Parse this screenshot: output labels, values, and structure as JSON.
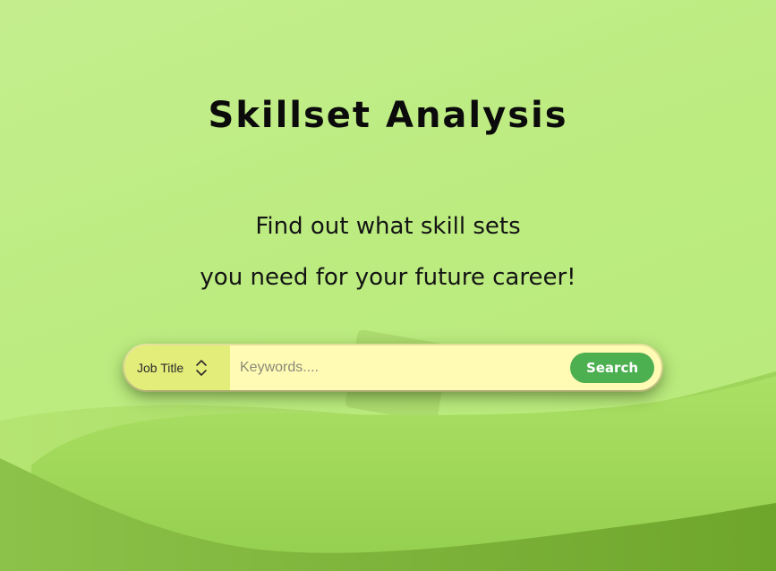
{
  "page": {
    "title": "Skillset Analysis",
    "subtitle_line_1": "Find out what skill sets",
    "subtitle_line_2": "you need for your future career!"
  },
  "search": {
    "category_selected": "Job Title",
    "keyword_placeholder": "Keywords....",
    "keyword_value": "",
    "button_label": "Search"
  },
  "icons": {
    "select": "chevron-up-down-icon"
  },
  "colors": {
    "background": "#bcec80",
    "search_field": "#fffbb4",
    "select_box": "#e3ed7a",
    "search_button": "#4caf50",
    "search_button_text": "#ffffff",
    "title_text": "#0b0b0b"
  }
}
